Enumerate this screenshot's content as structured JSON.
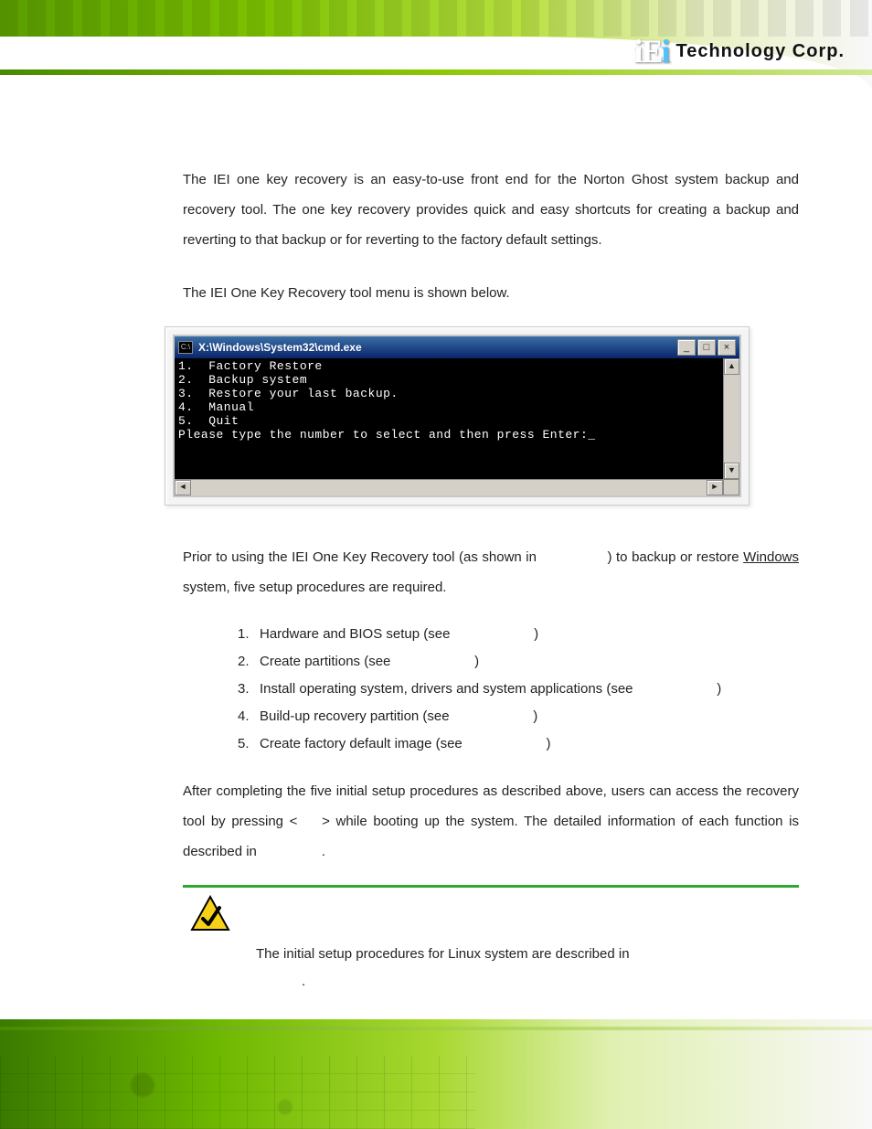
{
  "header": {
    "logo_text": "iEi",
    "reg": "®",
    "tech": "Technology Corp."
  },
  "intro_para": "The IEI one key recovery is an easy-to-use front end for the Norton Ghost system backup and recovery tool. The one key recovery provides quick and easy shortcuts for creating a backup and reverting to that backup or for reverting to the factory default settings.",
  "menu_line": "The IEI One Key Recovery tool menu is shown below.",
  "cmd": {
    "icon_label": "C:\\",
    "title": "X:\\Windows\\System32\\cmd.exe",
    "lines": [
      "1.  Factory Restore",
      "2.  Backup system",
      "3.  Restore your last backup.",
      "4.  Manual",
      "5.  Quit",
      "Please type the number to select and then press Enter:_"
    ],
    "btn_min": "_",
    "btn_max": "□",
    "btn_close": "×"
  },
  "prior_prefix": "Prior to using the IEI One Key Recovery tool (as shown in ",
  "prior_mid": ") to backup or restore ",
  "prior_windows": "Windows",
  "prior_suffix": " system, five setup procedures are required.",
  "steps": [
    {
      "n": "1.",
      "t": "Hardware and BIOS setup (see ",
      "close": ")"
    },
    {
      "n": "2.",
      "t": "Create partitions (see ",
      "close": ")"
    },
    {
      "n": "3.",
      "t": "Install operating system, drivers and system applications (see ",
      "close": ")"
    },
    {
      "n": "4.",
      "t": "Build-up recovery partition (see ",
      "close": ")"
    },
    {
      "n": "5.",
      "t": "Create factory default image (see ",
      "close": ")"
    }
  ],
  "after_prefix": "After completing the five initial setup procedures as described above, users can access the recovery tool by pressing <",
  "after_mid": "> while booting up the system. The detailed information of each function is described in ",
  "after_end": ".",
  "note_text": "The initial setup procedures for Linux system are described in",
  "note_end": "."
}
